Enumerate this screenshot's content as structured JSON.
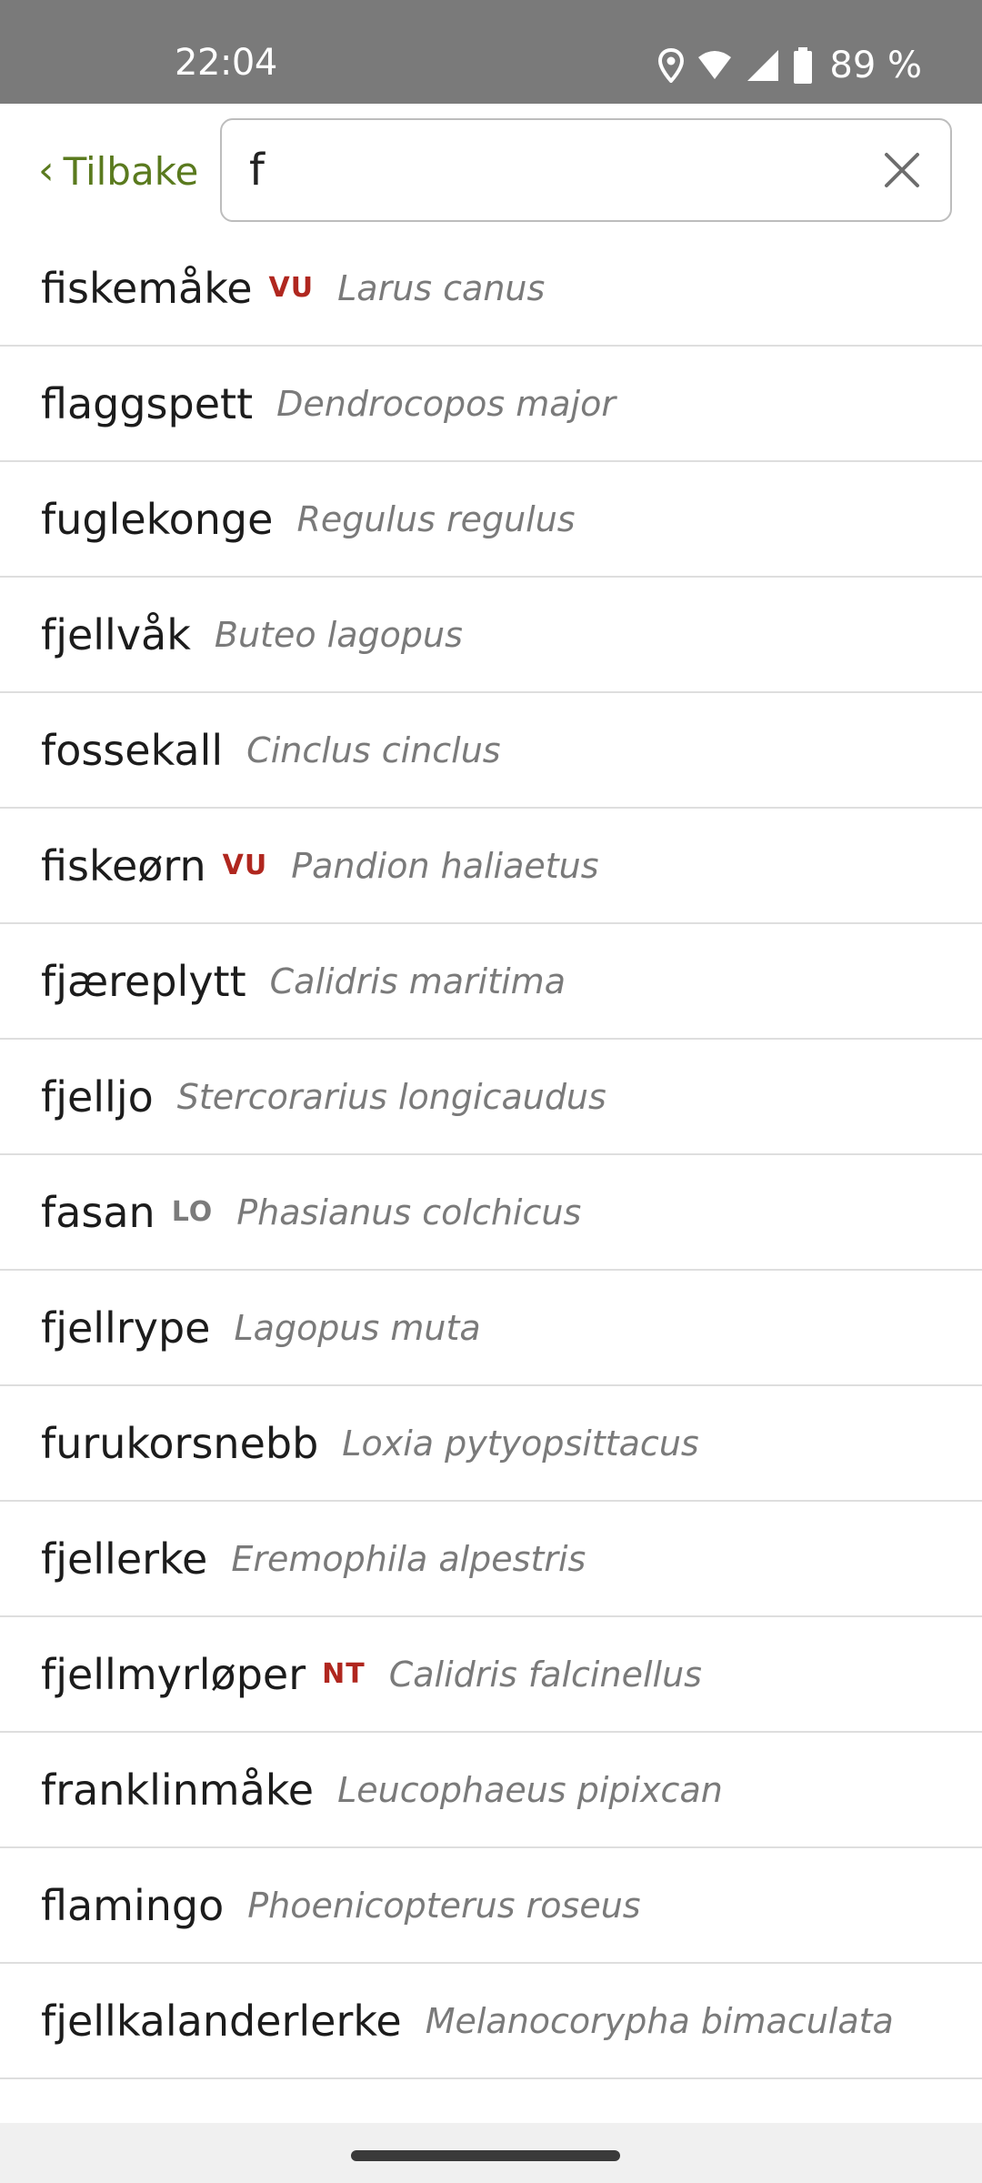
{
  "status_bar": {
    "time": "22:04",
    "battery": "89 %",
    "icons": [
      "location-icon",
      "wifi-icon",
      "signal-icon",
      "battery-icon"
    ]
  },
  "header": {
    "back_label": "Tilbake",
    "search_value": "f"
  },
  "colors": {
    "accent": "#5a7a1e",
    "redlist_badge": "#b0271f",
    "lo_badge": "#7b7b7b"
  },
  "results": [
    {
      "name": "fiskemåke",
      "badge": "VU",
      "latin": "Larus canus"
    },
    {
      "name": "flaggspett",
      "badge": "",
      "latin": "Dendrocopos major"
    },
    {
      "name": "fuglekonge",
      "badge": "",
      "latin": "Regulus regulus"
    },
    {
      "name": "fjellvåk",
      "badge": "",
      "latin": "Buteo lagopus"
    },
    {
      "name": "fossekall",
      "badge": "",
      "latin": "Cinclus cinclus"
    },
    {
      "name": "fiskeørn",
      "badge": "VU",
      "latin": "Pandion haliaetus"
    },
    {
      "name": "fjæreplytt",
      "badge": "",
      "latin": "Calidris maritima"
    },
    {
      "name": "fjelljo",
      "badge": "",
      "latin": "Stercorarius longicaudus"
    },
    {
      "name": "fasan",
      "badge": "LO",
      "latin": "Phasianus colchicus"
    },
    {
      "name": "fjellrype",
      "badge": "",
      "latin": "Lagopus muta"
    },
    {
      "name": "furukorsnebb",
      "badge": "",
      "latin": "Loxia pytyopsittacus"
    },
    {
      "name": "fjellerke",
      "badge": "",
      "latin": "Eremophila alpestris"
    },
    {
      "name": "fjellmyrløper",
      "badge": "NT",
      "latin": "Calidris falcinellus"
    },
    {
      "name": "franklinmåke",
      "badge": "",
      "latin": "Leucophaeus pipixcan"
    },
    {
      "name": "flamingo",
      "badge": "",
      "latin": "Phoenicopterus roseus"
    },
    {
      "name": "fjellkalanderlerke",
      "badge": "",
      "latin": "Melanocorypha bimaculata"
    }
  ]
}
